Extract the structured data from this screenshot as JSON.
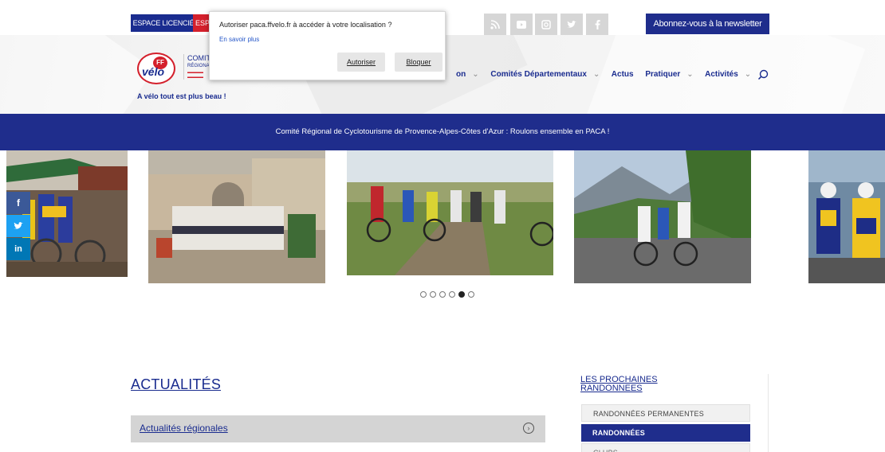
{
  "topbar": {
    "espace_licencie": "ESPACE LICENCIÉ",
    "espace_2": "ESP",
    "social_icons": [
      "rss-icon",
      "youtube-icon",
      "instagram-icon",
      "twitter-icon",
      "facebook-icon"
    ],
    "newsletter": "Abonnez-vous à la newsletter"
  },
  "geolocation_prompt": {
    "question": "Autoriser paca.ffvelo.fr à accéder à votre localisation ?",
    "learn_more": "En savoir plus",
    "allow": "Autoriser",
    "block": "Bloquer"
  },
  "header": {
    "logo_ff": "FF",
    "logo_velo": "vélo",
    "logo_text_1": "COMITÉ",
    "logo_text_2": "RÉGIONAL",
    "tagline": "A vélo tout est plus beau !",
    "nav": [
      {
        "label": "on",
        "dropdown": true
      },
      {
        "label": "Comités Départementaux",
        "dropdown": true
      },
      {
        "label": "Actus",
        "dropdown": false
      },
      {
        "label": "Pratiquer",
        "dropdown": true
      },
      {
        "label": "Activités",
        "dropdown": true
      }
    ]
  },
  "banner": {
    "text": "Comité Régional de Cyclotourisme de Provence-Alpes-Côtes d'Azur : Roulons ensemble en PACA !"
  },
  "carousel": {
    "slide_count": 6,
    "active_index": 4
  },
  "social_share": [
    "facebook-icon",
    "twitter-icon",
    "linkedin-icon"
  ],
  "main": {
    "title": "ACTUALITÉS",
    "category": "Actualités régionales"
  },
  "sidebar": {
    "title": "LES PROCHAINES RANDONNEES",
    "items": [
      {
        "label": "RANDONNÉES PERMANENTES",
        "active": false
      },
      {
        "label": "RANDONNÉES",
        "active": true
      },
      {
        "label": "CLUBS",
        "active": false
      }
    ]
  },
  "colors": {
    "brand_blue": "#1f2d8c",
    "brand_red": "#d4202c",
    "row_grey": "#d4d4d4"
  }
}
